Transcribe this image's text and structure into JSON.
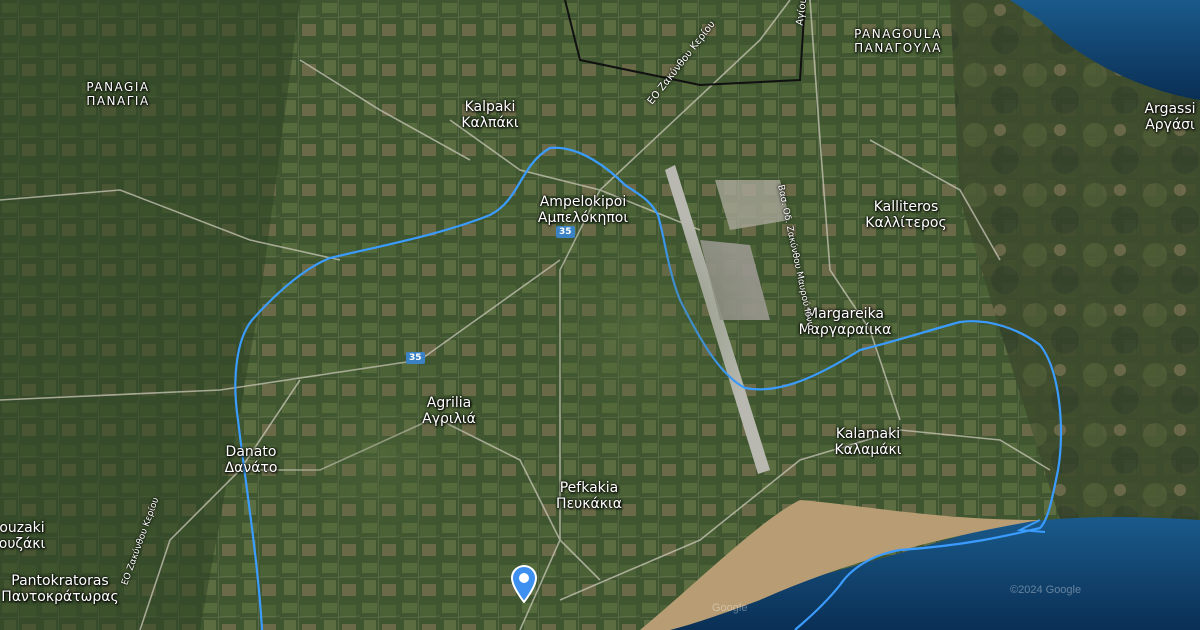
{
  "map": {
    "type": "satellite",
    "colors": {
      "route": "#3b9cff",
      "sea": "#0e3a63",
      "land": "#3f5630",
      "beach": "#b89d74",
      "runway": "#b8b8b0",
      "shield": "#3b82c4",
      "pin": "#3d8ff0"
    },
    "places": [
      {
        "latin": "PANAGIA",
        "greek": "ΠΑΝΑΓΙΑ",
        "style": "caps"
      },
      {
        "latin": "Kalpaki",
        "greek": "Καλπάκι"
      },
      {
        "latin": "PANAGOULA",
        "greek": "ΠΑΝΑΓΟΥΛΑ",
        "style": "caps"
      },
      {
        "latin": "Argassi",
        "greek": "Αργάσι"
      },
      {
        "latin": "Ampelokipoi",
        "greek": "Αμπελόκηποι"
      },
      {
        "latin": "Kalliteros",
        "greek": "Καλλίτερος"
      },
      {
        "latin": "Margareika",
        "greek": "Μαργαραίικα"
      },
      {
        "latin": "Agrilia",
        "greek": "Αγριλιά"
      },
      {
        "latin": "Kalamaki",
        "greek": "Καλαμάκι"
      },
      {
        "latin": "Danato",
        "greek": "Δανάτο"
      },
      {
        "latin": "Pefkakia",
        "greek": "Πευκάκια"
      },
      {
        "latin": "ouzaki",
        "greek": "ουζάκι"
      },
      {
        "latin": "Pantokratoras",
        "greek": "Παντοκράτωρας"
      }
    ],
    "route_shields": [
      "35",
      "35"
    ],
    "road_labels": [
      "ΕΟ Ζακύνθου Κερίου",
      "Αγίου Γερα",
      "Βασ. Οδ. Ζακύνθου Μαυρού Ιόνιο",
      "ΕΟ Ζακύνθου Κερίου"
    ],
    "watermarks": [
      "Google",
      "©2024 Google"
    ],
    "pin_icon": "location-pin-icon"
  }
}
